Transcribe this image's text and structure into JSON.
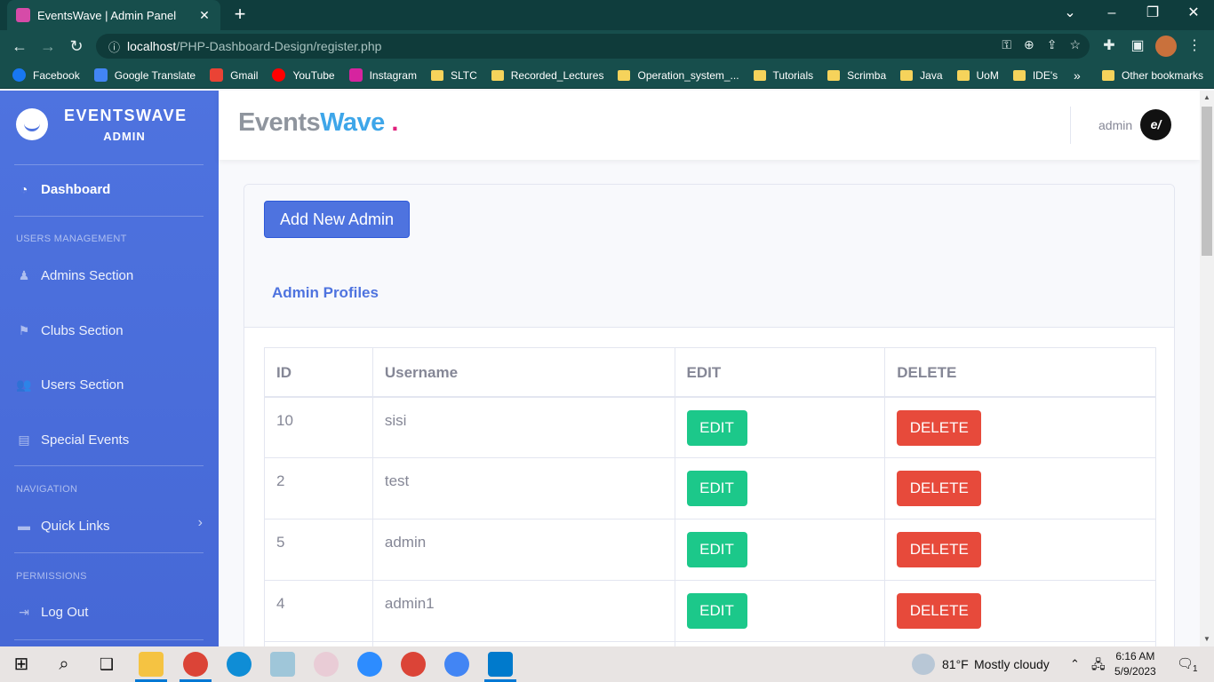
{
  "browser": {
    "tab_title": "EventsWave | Admin Panel",
    "url_host": "localhost",
    "url_path": "/PHP-Dashboard-Design/register.php",
    "bookmarks": [
      {
        "label": "Facebook",
        "kind": "facebook"
      },
      {
        "label": "Google Translate",
        "kind": "translate"
      },
      {
        "label": "Gmail",
        "kind": "gmail"
      },
      {
        "label": "YouTube",
        "kind": "youtube"
      },
      {
        "label": "Instagram",
        "kind": "instagram"
      },
      {
        "label": "SLTC",
        "kind": "folder"
      },
      {
        "label": "Recorded_Lectures",
        "kind": "folder"
      },
      {
        "label": "Operation_system_...",
        "kind": "folder"
      },
      {
        "label": "Tutorials",
        "kind": "folder"
      },
      {
        "label": "Scrimba",
        "kind": "folder"
      },
      {
        "label": "Java",
        "kind": "folder"
      },
      {
        "label": "UoM",
        "kind": "folder"
      },
      {
        "label": "IDE's",
        "kind": "folder"
      }
    ],
    "more_bookmarks": "»",
    "other_bookmarks": "Other bookmarks"
  },
  "sidebar": {
    "brand_line1": "EVENTSWAVE",
    "brand_line2": "ADMIN",
    "dashboard": "Dashboard",
    "heading_users": "USERS MANAGEMENT",
    "admins": "Admins Section",
    "clubs": "Clubs Section",
    "users": "Users Section",
    "special": "Special Events",
    "heading_nav": "NAVIGATION",
    "quick_links": "Quick Links",
    "heading_perm": "PERMISSIONS",
    "logout": "Log Out"
  },
  "topbar": {
    "logo_part1": "Events",
    "logo_part2": "Wave",
    "logo_dot": ".",
    "username": "admin",
    "avatar_text": "e/"
  },
  "main": {
    "add_button": "Add New Admin",
    "card_title": "Admin Profiles",
    "columns": [
      "ID",
      "Username",
      "EDIT",
      "DELETE"
    ],
    "edit_label": "EDIT",
    "delete_label": "DELETE",
    "rows": [
      {
        "id": "10",
        "username": "sisi"
      },
      {
        "id": "2",
        "username": "test"
      },
      {
        "id": "5",
        "username": "admin"
      },
      {
        "id": "4",
        "username": "admin1"
      }
    ]
  },
  "taskbar": {
    "weather_temp": "81°F",
    "weather_desc": "Mostly cloudy",
    "time": "6:16 AM",
    "date": "5/9/2023",
    "notification_count": "1"
  },
  "colors": {
    "primary": "#4e73df",
    "success": "#1cc88a",
    "danger": "#e74a3b",
    "chrome": "#174e4c"
  }
}
